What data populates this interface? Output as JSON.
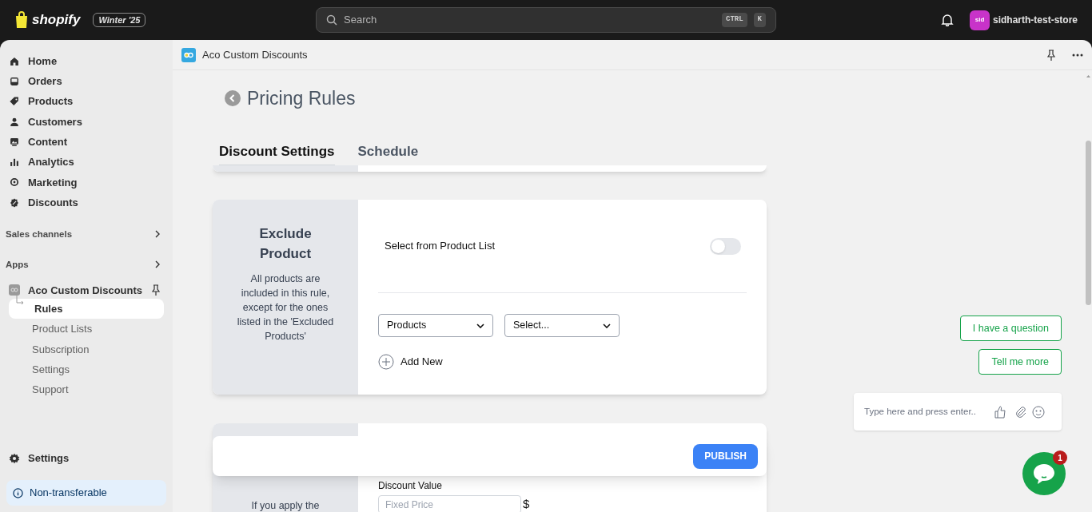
{
  "topbar": {
    "logo": "shopify",
    "edition": "Winter '25",
    "search": {
      "placeholder": "Search"
    },
    "shortcut": [
      "CTRL",
      "K"
    ],
    "avatar": "sid",
    "store": "sidharth-test-store"
  },
  "sidebar": {
    "items": [
      {
        "label": "Home",
        "selected": false
      },
      {
        "label": "Orders",
        "selected": false
      },
      {
        "label": "Products",
        "selected": false
      },
      {
        "label": "Customers",
        "selected": false
      },
      {
        "label": "Content",
        "selected": false
      },
      {
        "label": "Analytics",
        "selected": false
      },
      {
        "label": "Marketing",
        "selected": false
      },
      {
        "label": "Discounts",
        "selected": false
      }
    ],
    "sections": [
      "Sales channels",
      "Apps"
    ],
    "app": {
      "name": "Aco Custom Discounts",
      "children": [
        {
          "label": "Rules",
          "selected": true
        },
        {
          "label": "Product Lists",
          "selected": false
        },
        {
          "label": "Subscription",
          "selected": false
        },
        {
          "label": "Settings",
          "selected": false
        },
        {
          "label": "Support",
          "selected": false
        }
      ]
    },
    "settings": "Settings",
    "notice": "Non-transferable"
  },
  "app_header": {
    "title": "Aco Custom Discounts"
  },
  "page": {
    "title": "Pricing Rules",
    "tabs": [
      {
        "label": "Discount Settings",
        "selected": true
      },
      {
        "label": "Schedule",
        "selected": false
      }
    ],
    "exclude_card": {
      "title": "Exclude Product",
      "description": "All products are included in this rule, except for the ones listed in the 'Excluded Products'",
      "toggle": {
        "label": "Select from Product List",
        "on": false
      },
      "selects": [
        "Products",
        "Select..."
      ],
      "add_new": "Add New"
    },
    "price_card": {
      "description": "If you apply the",
      "field_label": "Discount Value",
      "input": {
        "placeholder": "Fixed Price"
      },
      "currency": "$"
    },
    "publish": "PUBLISH"
  },
  "chat": {
    "quick_replies": [
      "I have a question",
      "Tell me more"
    ],
    "input": {
      "placeholder": "Type here and press enter.."
    },
    "badge": "1"
  }
}
